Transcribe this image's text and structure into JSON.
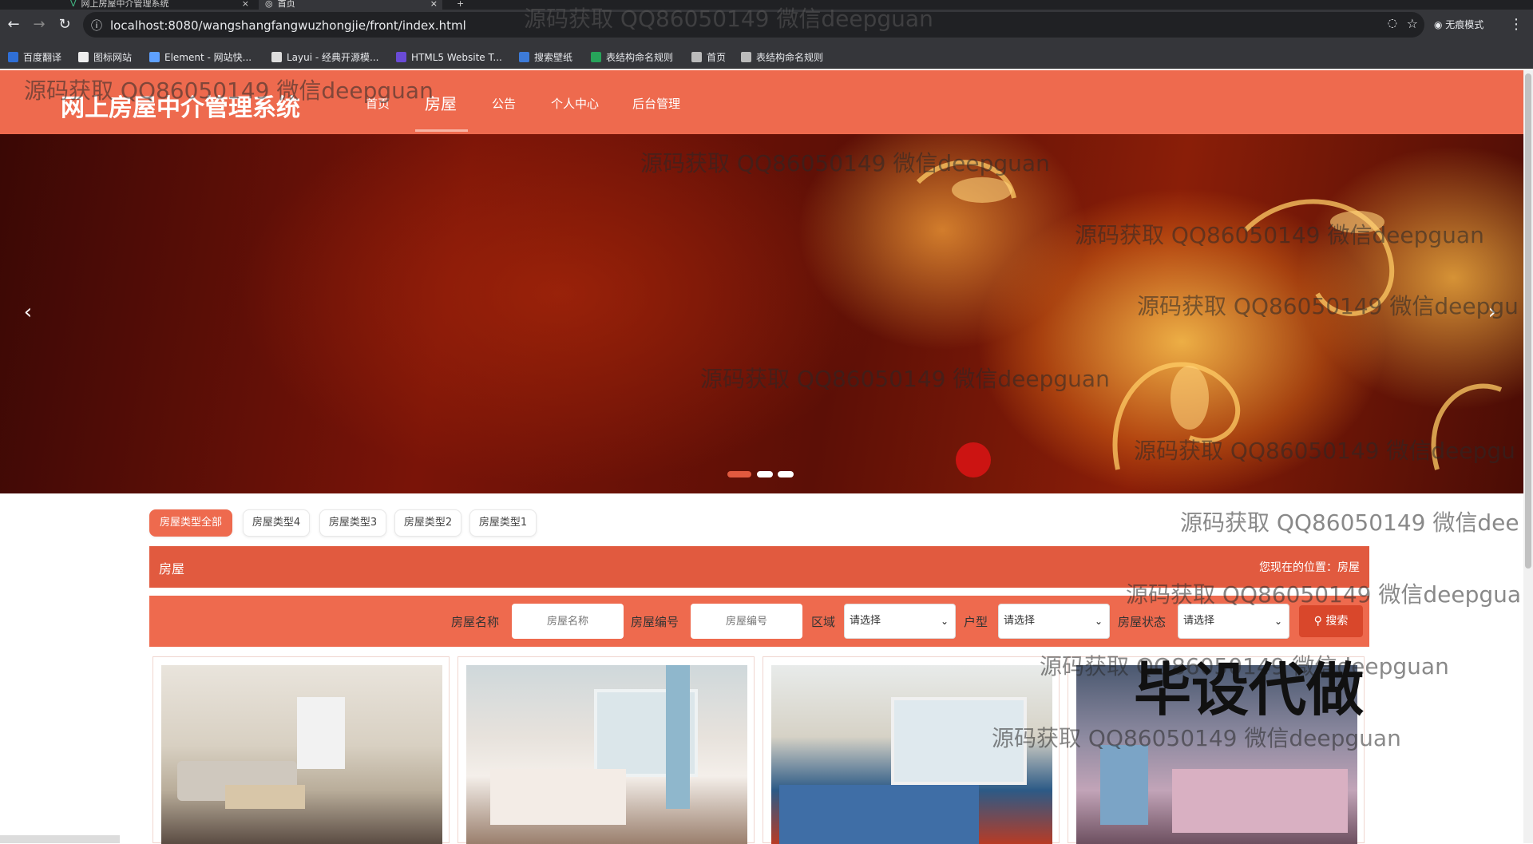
{
  "browser": {
    "tabs": [
      {
        "title": "网上房屋中介管理系统"
      },
      {
        "title": "首页"
      }
    ],
    "url": "localhost:8080/wangshangfangwuzhongjie/front/index.html",
    "profile_label": "无痕模式",
    "bookmarks": [
      {
        "label": "百度翻译",
        "color": "#2f6fd6"
      },
      {
        "label": "图标网站",
        "color": "#eeeeee"
      },
      {
        "label": "Element - 网站快...",
        "color": "#5ea1ff"
      },
      {
        "label": "Layui - 经典开源模...",
        "color": "#dddddd"
      },
      {
        "label": "HTML5 Website T...",
        "color": "#6a4bd6"
      },
      {
        "label": "搜索壁纸",
        "color": "#3d7bd8"
      },
      {
        "label": "表结构命名规则",
        "color": "#27a35a"
      },
      {
        "label": "首页",
        "color": "#bbbbbb"
      },
      {
        "label": "表结构命名规则",
        "color": "#bbbbbb"
      }
    ]
  },
  "site": {
    "title": "网上房屋中介管理系统",
    "nav": [
      {
        "label": "首页"
      },
      {
        "label": "房屋"
      },
      {
        "label": "公告"
      },
      {
        "label": "个人中心"
      },
      {
        "label": "后台管理"
      }
    ],
    "active_nav": "房屋",
    "accent_color": "#ee6a4e"
  },
  "carousel": {
    "prev_icon": "chevron-left-icon",
    "next_icon": "chevron-right-icon",
    "slide_count": 3,
    "active_slide": 1
  },
  "categories": [
    {
      "label": "房屋类型全部",
      "active": true
    },
    {
      "label": "房屋类型4"
    },
    {
      "label": "房屋类型3"
    },
    {
      "label": "房屋类型2"
    },
    {
      "label": "房屋类型1"
    }
  ],
  "breadcrumb": {
    "title": "房屋",
    "location_prefix": "您现在的位置：",
    "location": "房屋"
  },
  "search": {
    "name_label": "房屋名称",
    "name_placeholder": "房屋名称",
    "code_label": "房屋编号",
    "code_placeholder": "房屋编号",
    "area_label": "区域",
    "area_value": "请选择",
    "layout_label": "户型",
    "layout_value": "请选择",
    "status_label": "房屋状态",
    "status_value": "请选择",
    "button_label": "搜索"
  },
  "watermarks": {
    "repeat": "源码获取 QQ86050149 微信deepguan",
    "w_left": "源码获取 QQ86050149 微信deepguan",
    "w_right_clip1": "源码获取 QQ86050149 微信dee",
    "w_right_clip2": "源码获取 QQ86050149 微信deepgua",
    "w_right_clip3": "源码获取 QQ86050149 微信deepgu",
    "big_overlay": "毕设代做"
  }
}
